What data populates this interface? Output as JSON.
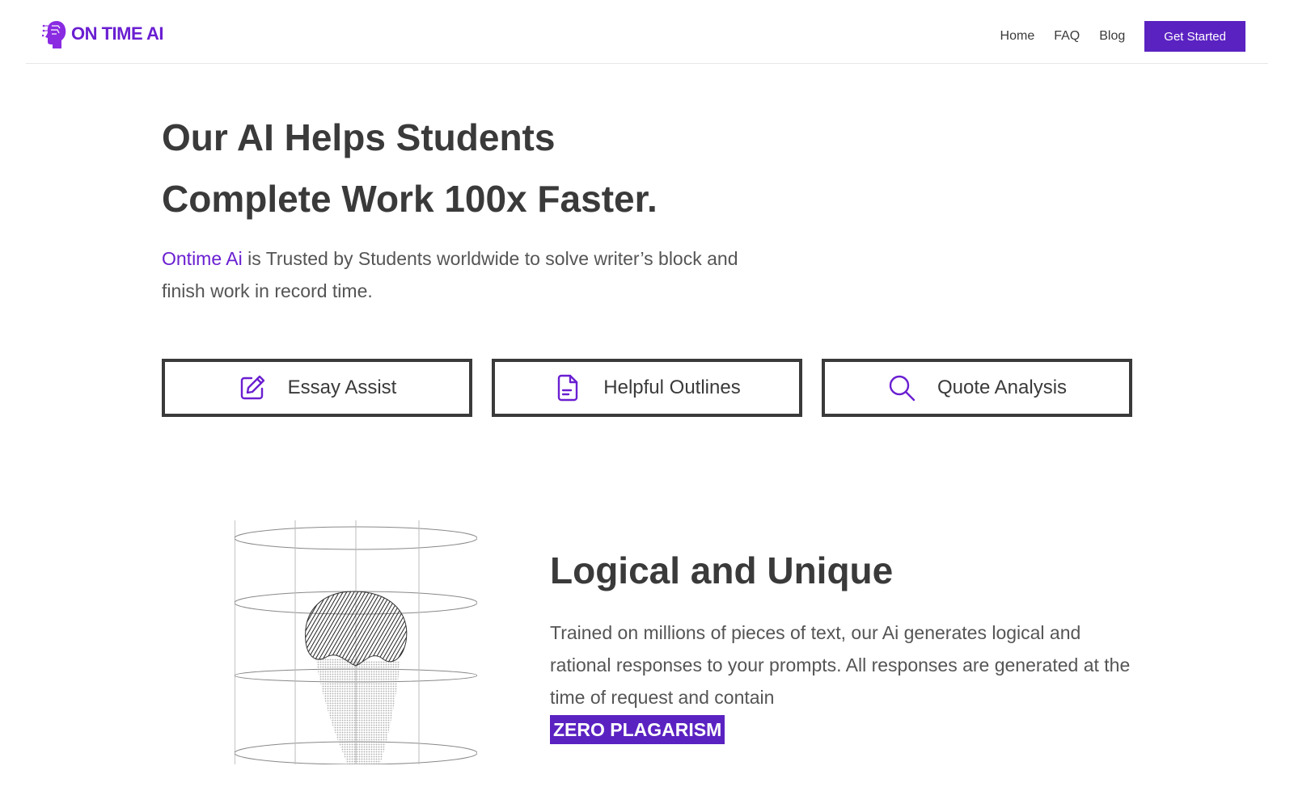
{
  "header": {
    "logo_text": "ON TIME AI",
    "nav": [
      "Home",
      "FAQ",
      "Blog"
    ],
    "cta_label": "Get Started"
  },
  "hero": {
    "title_line1": "Our AI Helps Students",
    "title_line2": "Complete Work 100x Faster.",
    "subtitle_brand": "Ontime Ai",
    "subtitle_rest": " is Trusted by Students worldwide to solve writer’s block and finish work in record time.",
    "features": [
      {
        "label": "Essay Assist",
        "icon": "pencil-square-icon"
      },
      {
        "label": "Helpful Outlines",
        "icon": "document-icon"
      },
      {
        "label": "Quote Analysis",
        "icon": "search-icon"
      }
    ]
  },
  "section2": {
    "title": "Logical and Unique",
    "body": "Trained on millions of pieces of text, our Ai generates logical and rational responses to your prompts. All responses are generated at the time of request and contain",
    "badge": "ZERO PLAGARISM"
  },
  "colors": {
    "accent": "#5b22c2",
    "brand_text": "#6a1fd1",
    "text": "#3a3a3a"
  }
}
